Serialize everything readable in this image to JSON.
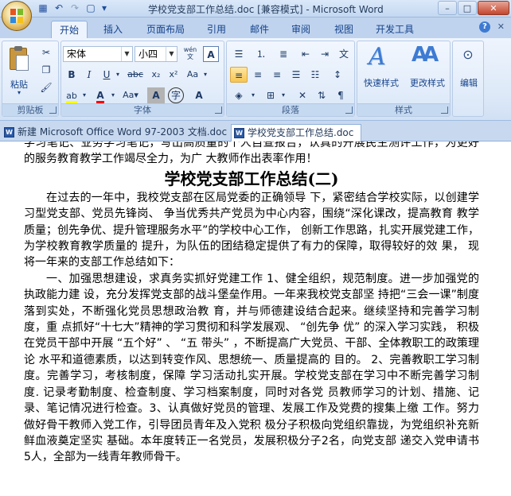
{
  "window": {
    "title": "学校党支部工作总结.doc [兼容模式] - Microsoft Word",
    "buttons": {
      "minimize": "–",
      "maximize": "□",
      "close": "✕"
    }
  },
  "quick_access": [
    {
      "name": "save-icon",
      "glyph": "💾"
    },
    {
      "name": "undo-icon",
      "glyph": "↶"
    },
    {
      "name": "redo-icon",
      "glyph": "↷"
    },
    {
      "name": "print-preview-icon",
      "glyph": "🔍"
    },
    {
      "name": "qat-dropdown-icon",
      "glyph": "▾"
    }
  ],
  "ribbon_tabs": [
    "开始",
    "插入",
    "页面布局",
    "引用",
    "邮件",
    "审阅",
    "视图",
    "开发工具"
  ],
  "ribbon_active_tab": "开始",
  "ribbon": {
    "clipboard": {
      "label": "剪贴板",
      "paste": "粘贴"
    },
    "font": {
      "label": "字体",
      "font_name": "宋体",
      "font_size": "小四",
      "wen": "wén",
      "grow": "A",
      "shrink": "A"
    },
    "paragraph": {
      "label": "段落"
    },
    "styles": {
      "label": "样式",
      "quick_styles": "快速样式",
      "change_styles": "更改样式"
    },
    "editing": {
      "label": "编辑"
    }
  },
  "doc_tabs": [
    {
      "label": "新建 Microsoft Office Word 97-2003 文档.doc",
      "active": false
    },
    {
      "label": "学校党支部工作总结.doc",
      "active": true
    }
  ],
  "document": {
    "lead": "学习笔记、业务学习笔记，写出高质量的个人自查报告，认真的开展民主测评工作，为更好的服务教育教学工作竭尽全力，为广 大教师作出表率作用！",
    "heading": "学校党支部工作总结(二)",
    "paragraphs": [
      "在过去的一年中，我校党支部在区局党委的正确领导 下，紧密结合学校实际，以创建学习型党支部、党员先锋岗、 争当优秀共产党员为中心内容，围绕“深化课改，提高教育 教学质量；创先争优、提升管理服务水平”的学校中心工作， 创新工作思路，扎实开展党建工作，为学校教育教学质量的 提升，为队伍的团结稳定提供了有力的保障，取得较好的效 果， 现将一年来的支部工作总结如下：",
      "一、加强思想建设，求真务实抓好党建工作 1、健全组织，规范制度。进一步加强党的执政能力建 设，充分发挥党支部的战斗堡垒作用。一年来我校党支部坚 持把“三会一课”制度落到实处，不断强化党员思想政治教 育，并与师德建设结合起来。继续坚持和完善学习制度，重 点抓好“十七大”精神的学习贯彻和科学发展观、 “创先争 优” 的深入学习实践， 积极在党员干部中开展 “五个好” 、 “五 带头” ，不断提高广大党员、干部、全体教职工的政策理论 水平和道德素质，以达到转变作风、思想统一、质量提高的 目的。 2、完善教职工学习制度。完善学习，考核制度，保障 学习活动扎实开展。学校党支部在学习中不断完善学习制 度. 记录考勤制度、检查制度、学习档案制度，同时对各党 员教师学习的计划、措施、记录、笔记情况进行检查。3、认真做好党员的管理、发展工作及党费的搜集上缴 工作。努力做好骨干教师入党工作，引导团员青年及入党积 极分子积极向党组织靠拢，为党组织补充新鲜血液奠定坚实 基础。本年度转正一名党员，发展积极分子2名，向党支部 递交入党申请书5人，全部为一线青年教师骨干。"
    ]
  }
}
